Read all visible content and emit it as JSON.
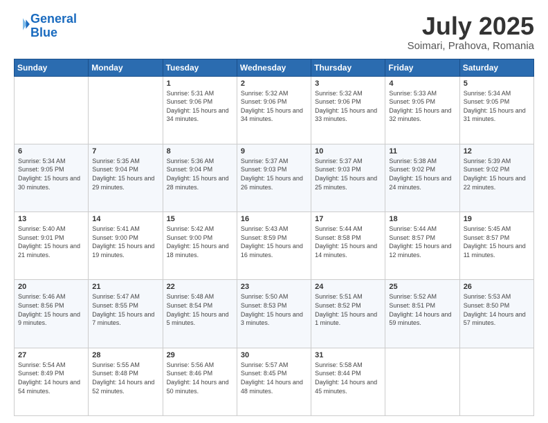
{
  "header": {
    "logo_line1": "General",
    "logo_line2": "Blue",
    "month_year": "July 2025",
    "location": "Soimari, Prahova, Romania"
  },
  "days_of_week": [
    "Sunday",
    "Monday",
    "Tuesday",
    "Wednesday",
    "Thursday",
    "Friday",
    "Saturday"
  ],
  "weeks": [
    [
      {
        "day": "",
        "info": ""
      },
      {
        "day": "",
        "info": ""
      },
      {
        "day": "1",
        "info": "Sunrise: 5:31 AM\nSunset: 9:06 PM\nDaylight: 15 hours and 34 minutes."
      },
      {
        "day": "2",
        "info": "Sunrise: 5:32 AM\nSunset: 9:06 PM\nDaylight: 15 hours and 34 minutes."
      },
      {
        "day": "3",
        "info": "Sunrise: 5:32 AM\nSunset: 9:06 PM\nDaylight: 15 hours and 33 minutes."
      },
      {
        "day": "4",
        "info": "Sunrise: 5:33 AM\nSunset: 9:05 PM\nDaylight: 15 hours and 32 minutes."
      },
      {
        "day": "5",
        "info": "Sunrise: 5:34 AM\nSunset: 9:05 PM\nDaylight: 15 hours and 31 minutes."
      }
    ],
    [
      {
        "day": "6",
        "info": "Sunrise: 5:34 AM\nSunset: 9:05 PM\nDaylight: 15 hours and 30 minutes."
      },
      {
        "day": "7",
        "info": "Sunrise: 5:35 AM\nSunset: 9:04 PM\nDaylight: 15 hours and 29 minutes."
      },
      {
        "day": "8",
        "info": "Sunrise: 5:36 AM\nSunset: 9:04 PM\nDaylight: 15 hours and 28 minutes."
      },
      {
        "day": "9",
        "info": "Sunrise: 5:37 AM\nSunset: 9:03 PM\nDaylight: 15 hours and 26 minutes."
      },
      {
        "day": "10",
        "info": "Sunrise: 5:37 AM\nSunset: 9:03 PM\nDaylight: 15 hours and 25 minutes."
      },
      {
        "day": "11",
        "info": "Sunrise: 5:38 AM\nSunset: 9:02 PM\nDaylight: 15 hours and 24 minutes."
      },
      {
        "day": "12",
        "info": "Sunrise: 5:39 AM\nSunset: 9:02 PM\nDaylight: 15 hours and 22 minutes."
      }
    ],
    [
      {
        "day": "13",
        "info": "Sunrise: 5:40 AM\nSunset: 9:01 PM\nDaylight: 15 hours and 21 minutes."
      },
      {
        "day": "14",
        "info": "Sunrise: 5:41 AM\nSunset: 9:00 PM\nDaylight: 15 hours and 19 minutes."
      },
      {
        "day": "15",
        "info": "Sunrise: 5:42 AM\nSunset: 9:00 PM\nDaylight: 15 hours and 18 minutes."
      },
      {
        "day": "16",
        "info": "Sunrise: 5:43 AM\nSunset: 8:59 PM\nDaylight: 15 hours and 16 minutes."
      },
      {
        "day": "17",
        "info": "Sunrise: 5:44 AM\nSunset: 8:58 PM\nDaylight: 15 hours and 14 minutes."
      },
      {
        "day": "18",
        "info": "Sunrise: 5:44 AM\nSunset: 8:57 PM\nDaylight: 15 hours and 12 minutes."
      },
      {
        "day": "19",
        "info": "Sunrise: 5:45 AM\nSunset: 8:57 PM\nDaylight: 15 hours and 11 minutes."
      }
    ],
    [
      {
        "day": "20",
        "info": "Sunrise: 5:46 AM\nSunset: 8:56 PM\nDaylight: 15 hours and 9 minutes."
      },
      {
        "day": "21",
        "info": "Sunrise: 5:47 AM\nSunset: 8:55 PM\nDaylight: 15 hours and 7 minutes."
      },
      {
        "day": "22",
        "info": "Sunrise: 5:48 AM\nSunset: 8:54 PM\nDaylight: 15 hours and 5 minutes."
      },
      {
        "day": "23",
        "info": "Sunrise: 5:50 AM\nSunset: 8:53 PM\nDaylight: 15 hours and 3 minutes."
      },
      {
        "day": "24",
        "info": "Sunrise: 5:51 AM\nSunset: 8:52 PM\nDaylight: 15 hours and 1 minute."
      },
      {
        "day": "25",
        "info": "Sunrise: 5:52 AM\nSunset: 8:51 PM\nDaylight: 14 hours and 59 minutes."
      },
      {
        "day": "26",
        "info": "Sunrise: 5:53 AM\nSunset: 8:50 PM\nDaylight: 14 hours and 57 minutes."
      }
    ],
    [
      {
        "day": "27",
        "info": "Sunrise: 5:54 AM\nSunset: 8:49 PM\nDaylight: 14 hours and 54 minutes."
      },
      {
        "day": "28",
        "info": "Sunrise: 5:55 AM\nSunset: 8:48 PM\nDaylight: 14 hours and 52 minutes."
      },
      {
        "day": "29",
        "info": "Sunrise: 5:56 AM\nSunset: 8:46 PM\nDaylight: 14 hours and 50 minutes."
      },
      {
        "day": "30",
        "info": "Sunrise: 5:57 AM\nSunset: 8:45 PM\nDaylight: 14 hours and 48 minutes."
      },
      {
        "day": "31",
        "info": "Sunrise: 5:58 AM\nSunset: 8:44 PM\nDaylight: 14 hours and 45 minutes."
      },
      {
        "day": "",
        "info": ""
      },
      {
        "day": "",
        "info": ""
      }
    ]
  ]
}
